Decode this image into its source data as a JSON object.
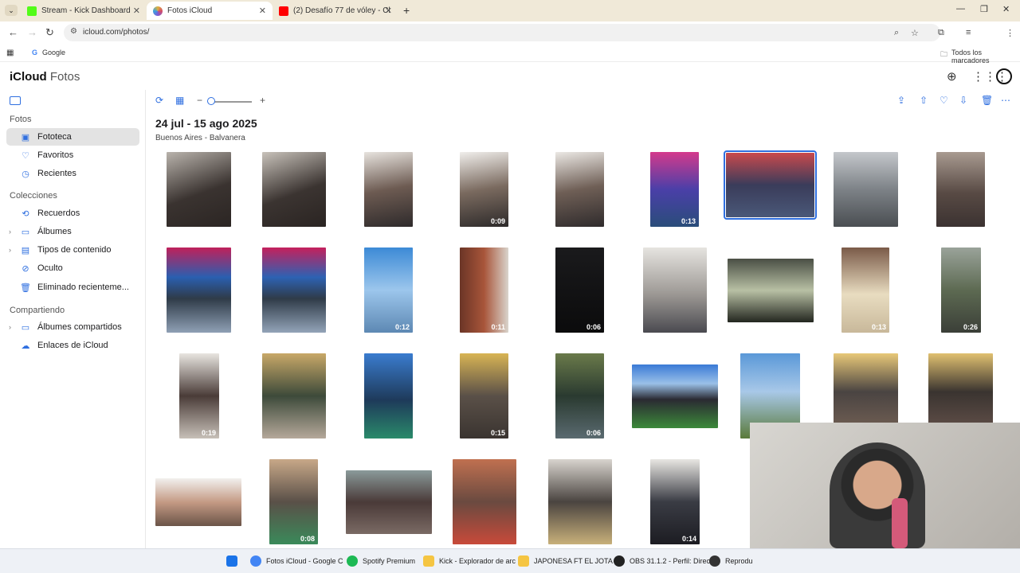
{
  "browser": {
    "tabs": [
      {
        "title": "Stream - Kick Dashboard",
        "color": "#53fc18"
      },
      {
        "title": "Fotos iCloud",
        "color": "#e0b33a"
      },
      {
        "title": "(2) Desafío 77 de vóley - Cl",
        "color": "#ff0000"
      }
    ],
    "url": "icloud.com/photos/",
    "bookmarks": {
      "google": "Google",
      "all": "Todos los marcadores"
    }
  },
  "app": {
    "brand": "iCloud",
    "section": "Fotos"
  },
  "sidebar": {
    "fotos_header": "Fotos",
    "colecciones_header": "Colecciones",
    "compartiendo_header": "Compartiendo",
    "items": [
      {
        "label": "Fototeca",
        "icon": "photo-library-icon"
      },
      {
        "label": "Favoritos",
        "icon": "heart-icon"
      },
      {
        "label": "Recientes",
        "icon": "clock-icon"
      },
      {
        "label": "Recuerdos",
        "icon": "memories-icon"
      },
      {
        "label": "Álbumes",
        "icon": "album-icon"
      },
      {
        "label": "Tipos de contenido",
        "icon": "stack-icon"
      },
      {
        "label": "Oculto",
        "icon": "eye-slash-icon"
      },
      {
        "label": "Eliminado recienteme...",
        "icon": "trash-icon"
      },
      {
        "label": "Álbumes compartidos",
        "icon": "shared-album-icon"
      },
      {
        "label": "Enlaces de iCloud",
        "icon": "cloud-link-icon"
      }
    ]
  },
  "main": {
    "date_range": "24 jul - 15 ago 2025",
    "location": "Buenos Aires - Balvanera",
    "durations": [
      "0:09",
      "0:13",
      "0:12",
      "0:11",
      "0:06",
      "0:13",
      "0:26",
      "0:19",
      "0:15",
      "0:06",
      "0:08",
      "0:14"
    ]
  },
  "taskbar": [
    {
      "label": "Fotos iCloud - Google C",
      "color": "#4285f4"
    },
    {
      "label": "Spotify Premium",
      "color": "#1db954"
    },
    {
      "label": "Kick - Explorador de arc",
      "color": "#f5c542"
    },
    {
      "label": "JAPONESA FT EL JOTA -",
      "color": "#f5c542"
    },
    {
      "label": "OBS 31.1.2 - Perfil: Direct",
      "color": "#222222"
    },
    {
      "label": "Reprodu",
      "color": "#333333"
    }
  ]
}
